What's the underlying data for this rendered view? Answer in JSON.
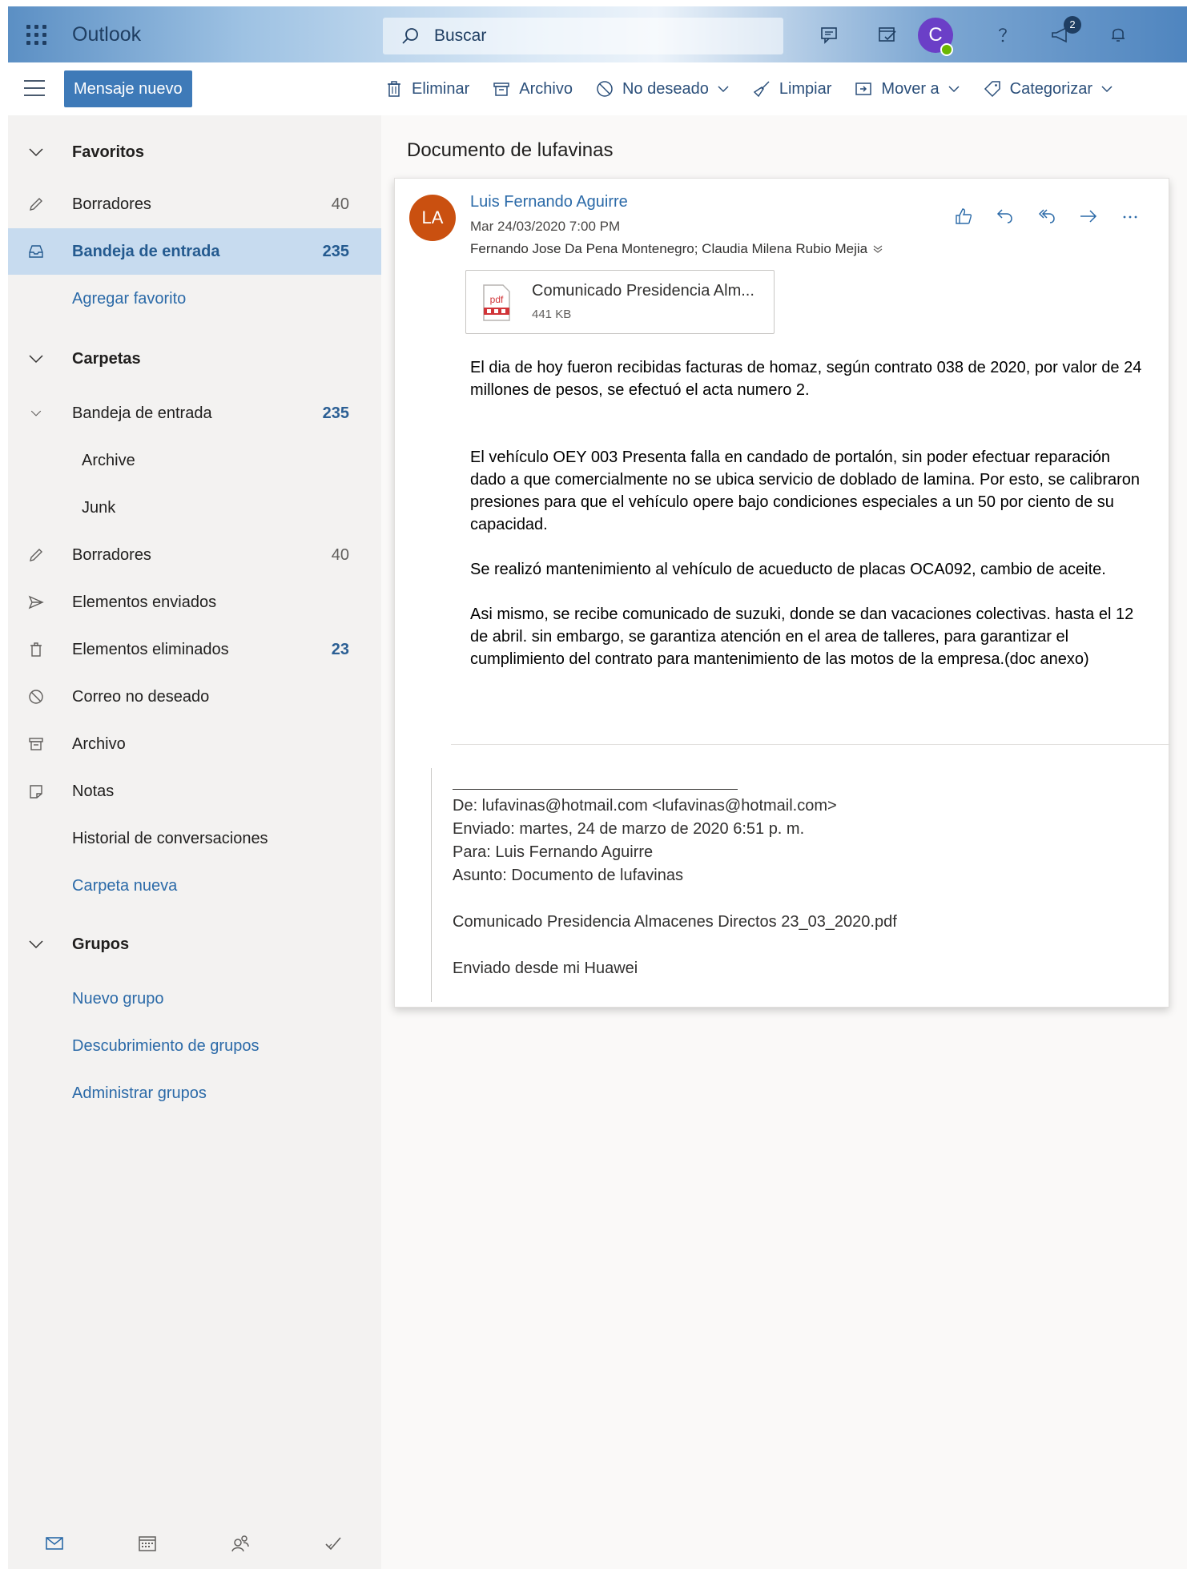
{
  "app": {
    "name": "Outlook",
    "search_placeholder": "Buscar",
    "notification_badge": "2",
    "avatar_initial": "C",
    "accent": "#3e7ab8"
  },
  "toolbar": {
    "new_message": "Mensaje nuevo",
    "delete": "Eliminar",
    "archive": "Archivo",
    "junk": "No deseado",
    "sweep": "Limpiar",
    "move_to": "Mover a",
    "categorize": "Categorizar"
  },
  "nav": {
    "favorites_header": "Favoritos",
    "favorites": [
      {
        "label": "Borradores",
        "count": "40",
        "icon": "pencil-icon"
      },
      {
        "label": "Bandeja de entrada",
        "count": "235",
        "icon": "inbox-icon",
        "selected": true
      },
      {
        "label": "Agregar favorito"
      }
    ],
    "folders_header": "Carpetas",
    "folders": [
      {
        "label": "Bandeja de entrada",
        "count": "235"
      },
      {
        "label": "Archive"
      },
      {
        "label": "Junk"
      },
      {
        "label": "Borradores",
        "count": "40",
        "icon": "pencil-icon"
      },
      {
        "label": "Elementos enviados",
        "icon": "send-icon"
      },
      {
        "label": "Elementos eliminados",
        "count": "23",
        "icon": "trash-icon"
      },
      {
        "label": "Correo no deseado",
        "icon": "block-icon"
      },
      {
        "label": "Archivo",
        "icon": "archive-icon"
      },
      {
        "label": "Notas",
        "icon": "note-icon"
      },
      {
        "label": "Historial de conversaciones"
      },
      {
        "label": "Carpeta nueva"
      }
    ],
    "groups_header": "Grupos",
    "groups": [
      {
        "label": "Nuevo grupo"
      },
      {
        "label": "Descubrimiento de grupos"
      },
      {
        "label": "Administrar grupos"
      }
    ]
  },
  "message": {
    "subject": "Documento de lufavinas",
    "sender_initials": "LA",
    "sender_name": "Luis Fernando Aguirre",
    "date": "Mar 24/03/2020 7:00 PM",
    "recipients": "Fernando Jose Da Pena Montenegro; Claudia Milena Rubio Mejia",
    "attachment": {
      "name": "Comunicado Presidencia Alm...",
      "size": "441 KB",
      "type_label": "pdf"
    },
    "body": [
      "El dia de hoy fueron recibidas facturas de homaz,  según contrato 038 de 2020, por valor de  24 millones de pesos,   se efectuó el acta numero 2.",
      "El vehículo OEY 003 Presenta falla en candado de portalón,  sin poder efectuar reparación dado a que comercialmente no se ubica servicio de doblado de lamina.  Por esto, se calibraron presiones para que el vehículo opere bajo condiciones especiales a un 50 por ciento de su capacidad.",
      "Se realizó mantenimiento al vehículo de acueducto de placas OCA092,  cambio de aceite.",
      "Asi mismo, se recibe comunicado de suzuki, donde se dan vacaciones colectivas. hasta el 12 de abril.  sin embargo, se garantiza atención en el area de talleres, para garantizar el cumplimiento del contrato para mantenimiento de las motos de la empresa.(doc anexo)"
    ],
    "quoted": {
      "from": "De: lufavinas@hotmail.com <lufavinas@hotmail.com>",
      "sent": "Enviado: martes, 24 de marzo de 2020 6:51 p. m.",
      "to": "Para: Luis Fernando Aguirre",
      "subject": "Asunto: Documento de lufavinas",
      "attachment_line": "Comunicado Presidencia Almacenes Directos 23_03_2020.pdf",
      "signature": "Enviado desde mi Huawei"
    }
  }
}
